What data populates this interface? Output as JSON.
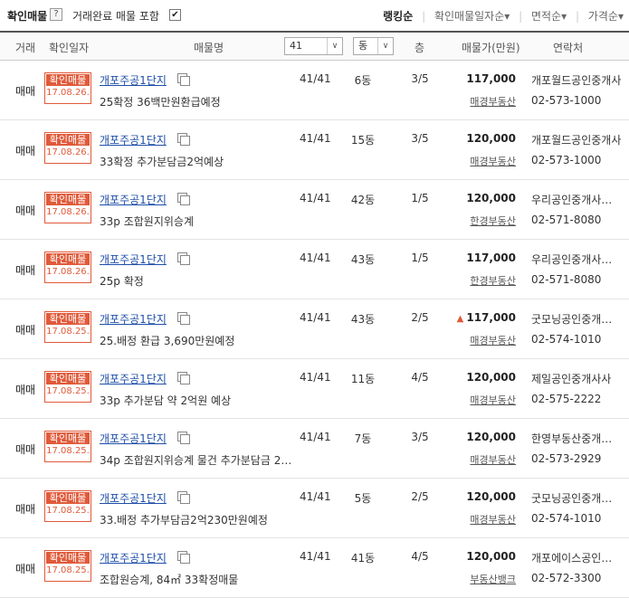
{
  "header": {
    "title": "확인매물",
    "help": "?",
    "include_completed": "거래완료 매물 포함",
    "include_checked": "✔",
    "sorts": [
      {
        "label": "랭킹순",
        "active": true
      },
      {
        "label": "확인매물일자순▾",
        "active": false
      },
      {
        "label": "면적순▾",
        "active": false
      },
      {
        "label": "가격순▾",
        "active": false
      }
    ]
  },
  "columns": {
    "deal": "거래",
    "confirm_date": "확인일자",
    "name": "매물명",
    "area_filter": "41",
    "dong_filter": "동",
    "floor": "층",
    "price": "매물가(만원)",
    "contact": "연락처",
    "dropdown_arrow": "∨"
  },
  "listings": [
    {
      "deal": "매매",
      "stamp_top": "확인매물",
      "stamp_date": "17.08.26.",
      "name": "개포주공1단지",
      "desc": "25확정 36백만원환급예정",
      "area": "41/41",
      "dong": "6동",
      "floor": "3/5",
      "price": "117,000",
      "price_up": false,
      "broker": "매경부동산",
      "agent": "개포월드공인중개사",
      "phone": "02-573-1000"
    },
    {
      "deal": "매매",
      "stamp_top": "확인매물",
      "stamp_date": "17.08.26.",
      "name": "개포주공1단지",
      "desc": "33확정 추가분담금2억예상",
      "area": "41/41",
      "dong": "15동",
      "floor": "3/5",
      "price": "120,000",
      "price_up": false,
      "broker": "매경부동산",
      "agent": "개포월드공인중개사",
      "phone": "02-573-1000"
    },
    {
      "deal": "매매",
      "stamp_top": "확인매물",
      "stamp_date": "17.08.26.",
      "name": "개포주공1단지",
      "desc": "33p 조합원지위승계",
      "area": "41/41",
      "dong": "42동",
      "floor": "1/5",
      "price": "120,000",
      "price_up": false,
      "broker": "한경부동산",
      "agent": "우리공인중개사사무소",
      "phone": "02-571-8080"
    },
    {
      "deal": "매매",
      "stamp_top": "확인매물",
      "stamp_date": "17.08.26.",
      "name": "개포주공1단지",
      "desc": "25p 확정",
      "area": "41/41",
      "dong": "43동",
      "floor": "1/5",
      "price": "117,000",
      "price_up": false,
      "broker": "한경부동산",
      "agent": "우리공인중개사사무소",
      "phone": "02-571-8080"
    },
    {
      "deal": "매매",
      "stamp_top": "확인매물",
      "stamp_date": "17.08.25.",
      "name": "개포주공1단지",
      "desc": "25.배정 환급 3,690만원예정",
      "area": "41/41",
      "dong": "43동",
      "floor": "2/5",
      "price": "117,000",
      "price_up": true,
      "broker": "매경부동산",
      "agent": "굿모닝공인중개사사무소",
      "phone": "02-574-1010"
    },
    {
      "deal": "매매",
      "stamp_top": "확인매물",
      "stamp_date": "17.08.25.",
      "name": "개포주공1단지",
      "desc": "33p 추가분담 약 2억원 예상",
      "area": "41/41",
      "dong": "11동",
      "floor": "4/5",
      "price": "120,000",
      "price_up": false,
      "broker": "매경부동산",
      "agent": "제일공인중개사사",
      "phone": "02-575-2222"
    },
    {
      "deal": "매매",
      "stamp_top": "확인매물",
      "stamp_date": "17.08.25.",
      "name": "개포주공1단지",
      "desc": "34p 조합원지위승계 물건 추가분담금 2…",
      "area": "41/41",
      "dong": "7동",
      "floor": "3/5",
      "price": "120,000",
      "price_up": false,
      "broker": "매경부동산",
      "agent": "한영부동산중개사사무소",
      "phone": "02-573-2929"
    },
    {
      "deal": "매매",
      "stamp_top": "확인매물",
      "stamp_date": "17.08.25.",
      "name": "개포주공1단지",
      "desc": "33.배정 추가부담금2억230만원예정",
      "area": "41/41",
      "dong": "5동",
      "floor": "2/5",
      "price": "120,000",
      "price_up": false,
      "broker": "매경부동산",
      "agent": "굿모닝공인중개사사무소",
      "phone": "02-574-1010"
    },
    {
      "deal": "매매",
      "stamp_top": "확인매물",
      "stamp_date": "17.08.25.",
      "name": "개포주공1단지",
      "desc": "조합원승계, 84㎡ 33확정매물",
      "area": "41/41",
      "dong": "41동",
      "floor": "4/5",
      "price": "120,000",
      "price_up": false,
      "broker": "부동산뱅크",
      "agent": "개포에이스공인중개사",
      "phone": "02-572-3300"
    }
  ]
}
